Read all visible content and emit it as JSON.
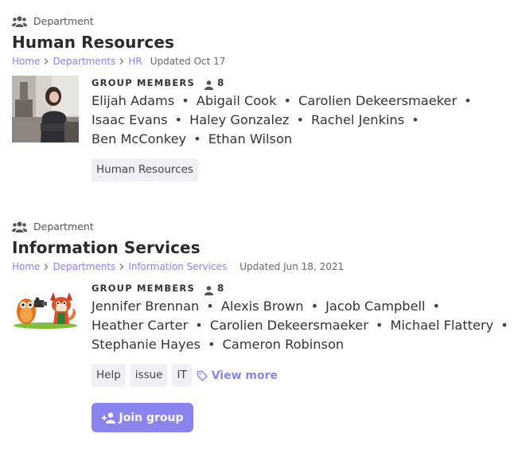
{
  "groups": [
    {
      "type_label": "Department",
      "title": "Human Resources",
      "breadcrumb": [
        "Home",
        "Departments",
        "HR"
      ],
      "updated": "Updated Oct 17",
      "members_label": "GROUP MEMBERS",
      "member_count": "8",
      "members": [
        "Elijah Adams",
        "Abigail Cook",
        "Carolien Dekeersmaeker",
        "Isaac Evans",
        "Haley Gonzalez",
        "Rachel Jenkins",
        "Ben McConkey",
        "Ethan Wilson"
      ],
      "tags": [
        "Human Resources"
      ]
    },
    {
      "type_label": "Department",
      "title": "Information Services",
      "breadcrumb": [
        "Home",
        "Departments",
        "Information Services"
      ],
      "updated": "Updated Jun 18, 2021",
      "members_label": "GROUP MEMBERS",
      "member_count": "8",
      "members": [
        "Jennifer Brennan",
        "Alexis Brown",
        "Jacob Campbell",
        "Heather Carter",
        "Carolien Dekeersmaeker",
        "Michael Flattery",
        "Stephanie Hayes",
        "Cameron Robinson"
      ],
      "tags": [
        "Help",
        "issue",
        "IT"
      ],
      "view_more": "View more",
      "join_label": "Join group"
    }
  ],
  "icons": {
    "department": "users-icon",
    "members": "user-icon",
    "breadcrumb_separator": "chevron-right-icon",
    "view_more": "tag-icon",
    "join": "user-plus-icon"
  },
  "colors": {
    "accent": "#8a84ee",
    "tag_bg": "#eef0f5",
    "text": "#2b2b2b"
  }
}
